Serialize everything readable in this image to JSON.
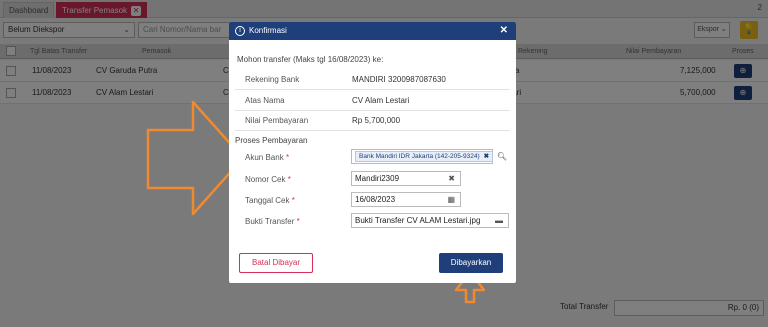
{
  "tabs": [
    {
      "label": "Dashboard"
    },
    {
      "label": "Transfer Pemasok",
      "close": "x"
    }
  ],
  "tab_count": "2",
  "toolbar": {
    "filter_value": "Belum Diekspor",
    "search_placeholder": "Cari Nomor/Nama bar",
    "export_label": "Ekspor",
    "bulb_icon": "lightbulb-icon"
  },
  "table": {
    "headers": {
      "date": "Tgl Batas Transfer",
      "supplier": "Pemasok",
      "account": "Rekening",
      "amount": "Nilai Pembayaran",
      "process": "Proses"
    },
    "rows": [
      {
        "date": "11/08/2023",
        "supplier": "CV Garuda Putra",
        "code": "C",
        "account": "tra",
        "amount": "7,125,000"
      },
      {
        "date": "11/08/2023",
        "supplier": "CV Alam Lestari",
        "code": "C",
        "account": "tari",
        "amount": "5,700,000"
      }
    ]
  },
  "footer": {
    "total_label": "Total Transfer",
    "total_value": "Rp. 0 (0)"
  },
  "modal": {
    "title": "Konfirmasi",
    "intro": "Mohon transfer (Maks tgl 16/08/2023) ke:",
    "bank_label": "Rekening Bank",
    "bank_value": "MANDIRI 3200987087630",
    "holder_label": "Atas Nama",
    "holder_value": "CV Alam Lestari",
    "amount_label": "Nilai Pembayaran",
    "amount_value": "Rp 5,700,000",
    "section_title": "Proses Pembayaran",
    "fields": {
      "account_label": "Akun Bank",
      "account_value": "Bank Mandiri IDR Jakarta (142-205-9324)",
      "cheque_label": "Nomor Cek",
      "cheque_value": "Mandiri2309",
      "date_label": "Tanggal Cek",
      "date_value": "16/08/2023",
      "proof_label": "Bukti Transfer",
      "proof_value": "Bukti Transfer CV ALAM Lestari.jpg"
    },
    "required_mark": "*",
    "cancel_label": "Batal Dibayar",
    "pay_label": "Dibayarkan"
  },
  "colors": {
    "primary": "#1e3f7a",
    "accent": "#d62f57",
    "annotation": "#f08a30"
  }
}
